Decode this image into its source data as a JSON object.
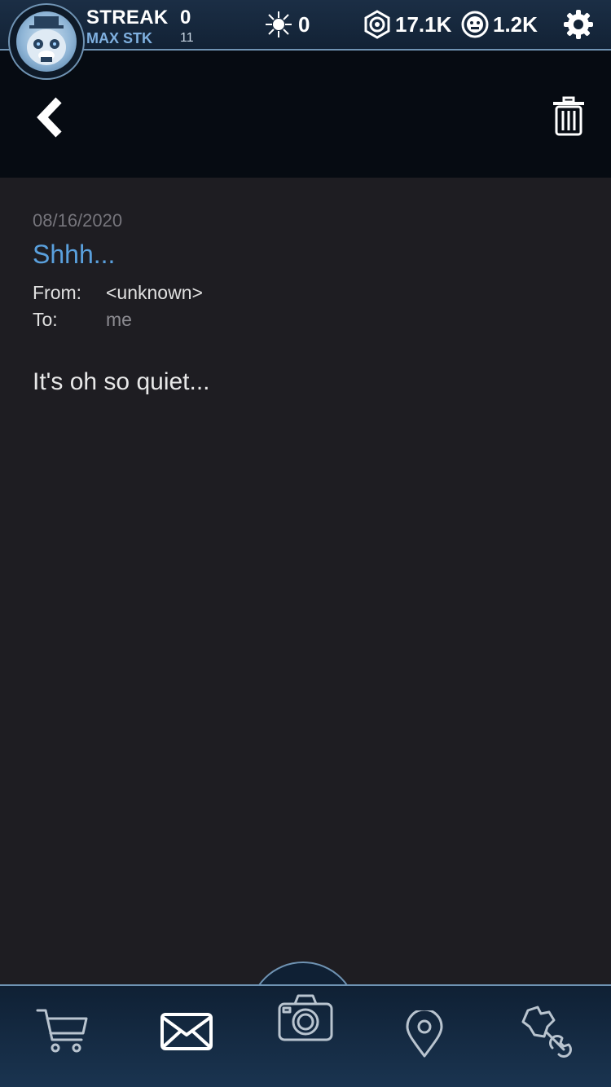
{
  "status": {
    "streak_label": "STREAK",
    "streak_value": "0",
    "max_streak_label": "MAX STK",
    "max_streak_value": "11",
    "remnant_count": "0",
    "faz_tokens": "17.1K",
    "faz_coins": "1.2K"
  },
  "message": {
    "date": "08/16/2020",
    "subject": "Shhh...",
    "from_label": "From:",
    "from_value": "<unknown>",
    "to_label": "To:",
    "to_value": "me",
    "body": "It's oh so quiet..."
  },
  "icons": {
    "back": "chevron-left-icon",
    "trash": "trash-icon",
    "settings": "gear-icon",
    "remnant": "remnant-icon",
    "tokens": "faz-token-icon",
    "coins": "faz-coin-icon",
    "nav": [
      "cart-icon",
      "mail-icon",
      "camera-icon",
      "map-pin-icon",
      "repair-icon"
    ]
  },
  "colors": {
    "accent_blue": "#5aa0dd",
    "panel_bg": "#1e1d22",
    "header_bg": "#060b12",
    "bar_border": "#6f93b3"
  }
}
